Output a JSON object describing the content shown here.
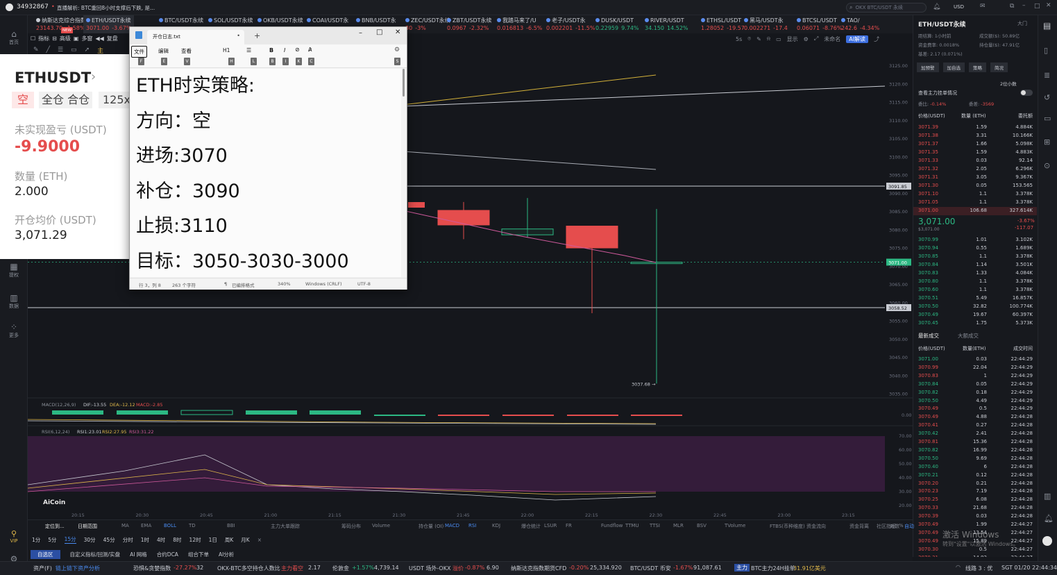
{
  "titlebar": {
    "account_id": "34932867",
    "news": "直播解析: BTC重回8小时支撑后下跌, 是...",
    "search_placeholder": "OKX BTC/USDT 永续",
    "currency": "USD"
  },
  "tabs": [
    {
      "name": "纳斯达克综合指数",
      "price": "23143.70",
      "chg": "-1.58%",
      "active": false,
      "up": false,
      "badge": "NEW"
    },
    {
      "name": "ETH/USDT永续",
      "price": "3071.00",
      "chg": "-3.67%",
      "active": true,
      "up": false
    },
    {
      "name": "BTC/USDT永续",
      "price": "",
      "chg": "",
      "active": false,
      "up": false
    },
    {
      "name": "SOL/USDT永续",
      "price": "",
      "chg": "",
      "active": false,
      "up": false
    },
    {
      "name": "OKB/USDT永续",
      "price": "",
      "chg": "",
      "active": false,
      "up": false
    },
    {
      "name": "COAI/USDT永",
      "price": "",
      "chg": "",
      "active": false,
      "up": false
    },
    {
      "name": "BNB/USDT永",
      "price": "",
      "chg": "",
      "active": false,
      "up": false
    },
    {
      "name": "ZEC/USDT永续",
      "price": "30",
      "chg": "-3%",
      "active": false,
      "up": false
    },
    {
      "name": "ZBT/USDT永续",
      "price": "0.0967",
      "chg": "-2.32%",
      "active": false,
      "up": false
    },
    {
      "name": "我踏马来了/U",
      "price": "0.016813",
      "chg": "-6.5%",
      "active": false,
      "up": false
    },
    {
      "name": "老子/USDT永",
      "price": "0.002201",
      "chg": "-11.5%",
      "active": false,
      "up": false
    },
    {
      "name": "DUSK/USDT",
      "price": "0.22959",
      "chg": "9.74%",
      "active": false,
      "up": true
    },
    {
      "name": "RIVER/USDT",
      "price": "34.150",
      "chg": "14.52%",
      "active": false,
      "up": true
    },
    {
      "name": "ETHSL/USDT",
      "price": "1.28052",
      "chg": "-19.57",
      "active": false,
      "up": false
    },
    {
      "name": "黑马/USDT永",
      "price": "0.002271",
      "chg": "-17.4",
      "active": false,
      "up": false
    },
    {
      "name": "BTCSL/USDT",
      "price": "0.06071",
      "chg": "-8.76%",
      "active": false,
      "up": false
    },
    {
      "name": "TAO/",
      "price": "242.6",
      "chg": "-4.34%",
      "active": false,
      "up": false
    }
  ],
  "toolbar": {
    "indicators": "指标",
    "advanced": "高级",
    "multi": "多窗",
    "replay": "复盘",
    "main": "主",
    "interval_5s": "5s",
    "display": "显示",
    "unnamed": "未命名",
    "ai_read": "AI解读"
  },
  "position": {
    "symbol": "ETHUSDT",
    "side": "空",
    "mode": "全仓 合仓",
    "leverage": "125x",
    "pnl_label": "未实现盈亏 (USDT)",
    "pnl_value": "-9.9000",
    "qty_label": "数量 (ETH)",
    "qty_value": "2.000",
    "avg_label": "开仓均价 (USDT)",
    "avg_value": "3,071.29"
  },
  "notepad": {
    "title": "开仓日志.txt",
    "menu": [
      "文件",
      "编辑",
      "查看"
    ],
    "heading_btn": "H1",
    "key_hints": [
      "F",
      "E",
      "V",
      "H",
      "L",
      "B",
      "I",
      "K",
      "C",
      "S"
    ],
    "lines": [
      "ETH时实策略:",
      "方向：空",
      "进场:3070",
      "补仓：3090",
      "止损:3110",
      "目标：3050-3030-3000"
    ],
    "status": {
      "pos": "行 3，列 8",
      "chars": "263 个字符",
      "format": "已编排格式",
      "zoom": "340%",
      "eol": "Windows (CRLF)",
      "enc": "UTF-8"
    }
  },
  "chart": {
    "yticks": [
      "3125.00",
      "3120.00",
      "3115.00",
      "3110.00",
      "3105.00",
      "3100.00",
      "3095.00",
      "3090.00",
      "3085.00",
      "3080.00",
      "3075.00",
      "3070.00",
      "3065.00",
      "3060.00",
      "3055.00",
      "3050.00",
      "3045.00",
      "3040.00",
      "3035.00"
    ],
    "price_tags": {
      "line1": "3091.85",
      "current": "3071.00",
      "line2": "3058.52"
    },
    "low_label": "3037.68",
    "macd_label": "MACD(12,26,9)",
    "macd_dif": "DIF:-13.55",
    "macd_dea": "DEA:-12.12",
    "macd_macd": "MACD:-2.85",
    "macd_zero": "0.00",
    "rsi_label": "RSI(6,12,24)",
    "rsi1": "RSI1:23.01",
    "rsi2": "RSI2:27.95",
    "rsi3": "RSI3:31.22",
    "rsi_ticks": [
      "70.00",
      "60.00",
      "50.00",
      "40.00",
      "30.00",
      "20.00"
    ],
    "xticks": [
      "20:15",
      "20:30",
      "20:45",
      "21:00",
      "21:15",
      "21:30",
      "21:45",
      "22:00",
      "22:15",
      "22:30",
      "22:45",
      "23:00",
      "23:15"
    ],
    "brand": "AiCoin"
  },
  "chart_data": {
    "type": "candlestick",
    "x": [
      "21:45",
      "22:00",
      "22:15",
      "22:30"
    ],
    "candles": [
      {
        "open": 3085.2,
        "high": 3087.5,
        "low": 3077.3,
        "close": 3081.2
      },
      {
        "open": 3078.5,
        "high": 3088.6,
        "low": 3077.8,
        "close": 3080.1
      },
      {
        "open": 3080.9,
        "high": 3080.9,
        "low": 3057.0,
        "close": 3074.9
      },
      {
        "open": 3070.6,
        "high": 3085.6,
        "low": 3037.68,
        "close": 3071.0
      }
    ],
    "ylim": [
      3030,
      3127
    ]
  },
  "bottom": {
    "tools": [
      "定位到...",
      "日期范围",
      "MA",
      "EMA",
      "BOLL",
      "TD",
      "BBI",
      "主力大单跟踪",
      "筹码分布",
      "Volume",
      "持仓量 (OI)",
      "MACD",
      "RSI",
      "KDJ",
      "爆仓统计",
      "LSUR",
      "FR",
      "Fundflow",
      "TTMU",
      "TTSI",
      "MLR",
      "BSV",
      "TVolume",
      "FTBS(币种维度)",
      "资金流向",
      "资金背离",
      "社区指标",
      "对数",
      "%",
      "自动"
    ],
    "intervals": [
      "1分",
      "5分",
      "15分",
      "30分",
      "45分",
      "分时",
      "1时",
      "4时",
      "8时",
      "12时",
      "1日",
      "周K",
      "月K"
    ],
    "active_interval": "15分",
    "subtabs": [
      "自选区",
      "自定义指标/回测/实盘",
      "AI 网格",
      "合约DCA",
      "组合下单",
      "AI分析"
    ]
  },
  "statusbar": {
    "assets": "资产(F)",
    "link": "链上链下资产分析",
    "fear_label": "恐惧&贪婪指数",
    "fear_chg": "-27.27%",
    "fear_val": "32",
    "okx_label": "OKX-BTC多空持仓人数比",
    "okx_tag": "主力看空",
    "okx_val": "2.17",
    "lunjin_label": "伦敦金",
    "lunjin_chg": "+1.57%",
    "lunjin_val": "4,739.14",
    "usdt_label": "USDT 场外-OKX",
    "usdt_tag": "溢价",
    "usdt_chg": "-0.87%",
    "usdt_val": "6.90",
    "nasdaq_label": "纳斯达克指数期货CFD",
    "nasdaq_chg": "-0.20%",
    "nasdaq_val": "25,334.920",
    "btc_label": "BTC/USDT 币安",
    "btc_chg": "-1.67%",
    "btc_val": "91,087.61",
    "main_tag": "主力",
    "btc24": "BTC主力24H挂单",
    "btc24_val": "31.91亿美元",
    "line": "线路 3 : 优",
    "time": "SGT 01/20 22:44:34"
  },
  "right": {
    "symbol": "ETH/USDT永续",
    "big_market": "大门",
    "holders_label": "距结算: 1小时前",
    "funding_label": "资金费率: 0.0018%",
    "basis_label": "基差: 2.17 (0.071%)",
    "volume_label": "成交额($): 50.89亿",
    "oi_label": "持仓量($): 47.91亿",
    "buttons": [
      "加预警",
      "加自选",
      "策略",
      "简况"
    ],
    "decimals": "2位小数",
    "main_orders": "查看主力挂单情况",
    "ratio_label": "委比:",
    "ratio_val": "-0.14%",
    "diff_label": "委差:",
    "diff_val": "-3569",
    "ob_headers": [
      "价格(USDT)",
      "数量 (ETH)",
      "委托额"
    ],
    "asks": [
      [
        "3071.39",
        "1.59",
        "4.884K"
      ],
      [
        "3071.38",
        "3.31",
        "10.166K"
      ],
      [
        "3071.37",
        "1.66",
        "5.098K"
      ],
      [
        "3071.35",
        "1.59",
        "4.883K"
      ],
      [
        "3071.33",
        "0.03",
        "92.14"
      ],
      [
        "3071.32",
        "2.05",
        "6.296K"
      ],
      [
        "3071.31",
        "3.05",
        "9.367K"
      ],
      [
        "3071.30",
        "0.05",
        "153.565"
      ],
      [
        "3071.10",
        "1.1",
        "3.378K"
      ],
      [
        "3071.05",
        "1.1",
        "3.378K"
      ],
      [
        "3071.00",
        "106.68",
        "327.614K"
      ]
    ],
    "mid_price": "3,071.00",
    "mid_usd": "$3,071.00",
    "mid_chg": "-3.67%",
    "mid_diff": "-117.07",
    "bids": [
      [
        "3070.99",
        "1.01",
        "3.102K"
      ],
      [
        "3070.94",
        "0.55",
        "1.689K"
      ],
      [
        "3070.85",
        "1.1",
        "3.378K"
      ],
      [
        "3070.84",
        "1.14",
        "3.501K"
      ],
      [
        "3070.83",
        "1.33",
        "4.084K"
      ],
      [
        "3070.80",
        "1.1",
        "3.378K"
      ],
      [
        "3070.60",
        "1.1",
        "3.378K"
      ],
      [
        "3070.51",
        "5.49",
        "16.857K"
      ],
      [
        "3070.50",
        "32.82",
        "100.774K"
      ],
      [
        "3070.49",
        "19.67",
        "60.397K"
      ],
      [
        "3070.45",
        "1.75",
        "5.373K"
      ]
    ],
    "trades_tabs": [
      "最新成交",
      "大额成交"
    ],
    "trades_headers": [
      "价格(USDT)",
      "数量(ETH)",
      "成交时间"
    ],
    "trades": [
      [
        "3071.00",
        "0.03",
        "22:44:29",
        "g"
      ],
      [
        "3070.99",
        "22.04",
        "22:44:29",
        "r"
      ],
      [
        "3070.83",
        "1",
        "22:44:29",
        "r"
      ],
      [
        "3070.84",
        "0.05",
        "22:44:29",
        "g"
      ],
      [
        "3070.82",
        "0.18",
        "22:44:29",
        "g"
      ],
      [
        "3070.50",
        "4.49",
        "22:44:29",
        "g"
      ],
      [
        "3070.49",
        "0.5",
        "22:44:29",
        "r"
      ],
      [
        "3070.49",
        "4.88",
        "22:44:28",
        "r"
      ],
      [
        "3070.41",
        "0.27",
        "22:44:28",
        "r"
      ],
      [
        "3070.42",
        "2.41",
        "22:44:28",
        "g"
      ],
      [
        "3070.81",
        "15.36",
        "22:44:28",
        "r"
      ],
      [
        "3070.82",
        "16.99",
        "22:44:28",
        "g"
      ],
      [
        "3070.50",
        "9.69",
        "22:44:28",
        "g"
      ],
      [
        "3070.40",
        "6",
        "22:44:28",
        "g"
      ],
      [
        "3070.21",
        "0.12",
        "22:44:28",
        "g"
      ],
      [
        "3070.20",
        "0.21",
        "22:44:28",
        "r"
      ],
      [
        "3070.23",
        "7.19",
        "22:44:28",
        "r"
      ],
      [
        "3070.25",
        "6.08",
        "22:44:28",
        "r"
      ],
      [
        "3070.33",
        "21.68",
        "22:44:28",
        "r"
      ],
      [
        "3070.39",
        "0.03",
        "22:44:28",
        "r"
      ],
      [
        "3070.49",
        "1.99",
        "22:44:27",
        "r"
      ],
      [
        "3070.49",
        "13.54",
        "22:44:27",
        "r"
      ],
      [
        "3070.49",
        "15.89",
        "22:44:27",
        "r"
      ],
      [
        "3070.30",
        "0.5",
        "22:44:27",
        "r"
      ],
      [
        "3070.31",
        "14.92",
        "22:44:27",
        "r"
      ]
    ]
  },
  "watermark": {
    "line1": "激活 Windows",
    "line2": "转到\"设置\"以激活 Windows。"
  },
  "left_items": [
    "首页",
    "提权",
    "数据",
    "更多",
    "VIP"
  ]
}
